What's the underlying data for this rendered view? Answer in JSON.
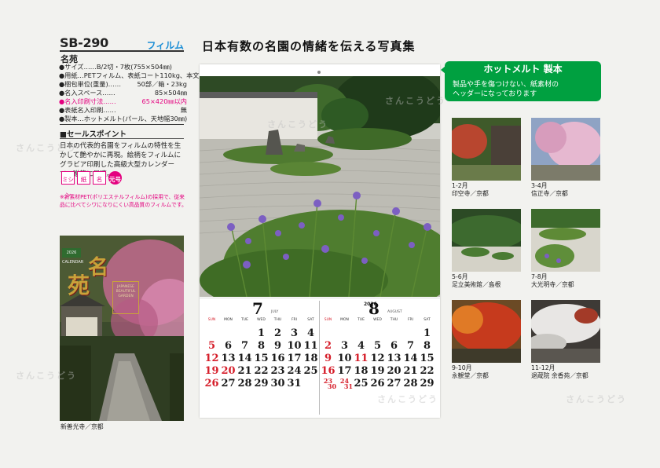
{
  "product": {
    "code": "SB-290",
    "tag": "フィルム",
    "name": "名苑"
  },
  "specs": [
    {
      "label": "●サイズ……B/2切・7枚(755×504㎜)",
      "value": "",
      "pink": false
    },
    {
      "label": "●用紙…PETフィルム、表紙コート110kg、本文ケント110kg",
      "value": "",
      "pink": false
    },
    {
      "label": "●梱包単位(重量)……",
      "value": "50部／箱・23kg",
      "pink": false
    },
    {
      "label": "●名入スペース……",
      "value": "85×504㎜",
      "pink": false
    },
    {
      "label": "●名入印刷寸法……",
      "value": "65×420㎜以内",
      "pink": true
    },
    {
      "label": "●表紙名入印刷……",
      "value": "無",
      "pink": false
    },
    {
      "label": "●製本…ホットメルト(パール、天地幅30㎜)",
      "value": "",
      "pink": false
    }
  ],
  "sales": {
    "heading": "■セールスポイント",
    "text": "日本の代表的名園をフィルムの特性を生かして艶やかに再現。絵柄をフィルムにグラビア印刷した高級大型カレンダーで、贈答に最適。",
    "badges": [
      "ミシン",
      "紙",
      "名",
      "元号"
    ],
    "pet_note": "※新素材PET(ポリエステルフィルム)の採用で、従来品に比べてシワになりにくい高品質のフィルムです。"
  },
  "cover": {
    "small_badge": "2026 CALENDAR",
    "title_1": "名",
    "title_2": "苑",
    "box_text": "JAPANESE BEAUTIFUL GARDEN",
    "caption": "新善光寺／京都"
  },
  "main_heading": "日本有数の名園の情緒を伝える写真集",
  "calendar": {
    "left": {
      "month": "7",
      "en": "JULY",
      "year": "",
      "weekdays": [
        "SUN",
        "MON",
        "TUE",
        "WED",
        "THU",
        "FRI",
        "SAT"
      ],
      "weeks": [
        [
          "",
          "",
          "",
          "1",
          "2",
          "3",
          "4"
        ],
        [
          "5",
          "6",
          "7",
          "8",
          "9",
          "10",
          "11"
        ],
        [
          "12",
          "13",
          "14",
          "15",
          "16",
          "17",
          "18"
        ],
        [
          "19",
          "20",
          "21",
          "22",
          "23",
          "24",
          "25"
        ],
        [
          "26",
          "27",
          "28",
          "29",
          "30",
          "31",
          ""
        ]
      ],
      "holidays": [
        "20"
      ]
    },
    "right": {
      "month": "8",
      "en": "AUGUST",
      "year": "2026",
      "weekdays": [
        "SUN",
        "MON",
        "TUE",
        "WED",
        "THU",
        "FRI",
        "SAT"
      ],
      "weeks": [
        [
          "",
          "",
          "",
          "",
          "",
          "",
          "1"
        ],
        [
          "2",
          "3",
          "4",
          "5",
          "6",
          "7",
          "8"
        ],
        [
          "9",
          "10",
          "11",
          "12",
          "13",
          "14",
          "15"
        ],
        [
          "16",
          "17",
          "18",
          "19",
          "20",
          "21",
          "22"
        ],
        [
          "23/30",
          "24/31",
          "25",
          "26",
          "27",
          "28",
          "29"
        ]
      ],
      "holidays": [
        "11"
      ]
    }
  },
  "hotmelt": {
    "title": "ホットメルト 製本",
    "line1": "製品や手を傷つけない、紙素材の",
    "line2": "ヘッダーになっております"
  },
  "thumbnails": [
    {
      "months": "1-2月",
      "place": "印空寺／京都"
    },
    {
      "months": "3-4月",
      "place": "信正寺／京都"
    },
    {
      "months": "5-6月",
      "place": "足立美術館／島根"
    },
    {
      "months": "7-8月",
      "place": "大光明寺／京都"
    },
    {
      "months": "9-10月",
      "place": "永観堂／京都"
    },
    {
      "months": "11-12月",
      "place": "退蔵院 余香苑／京都"
    }
  ],
  "watermark": "さんこうどう"
}
